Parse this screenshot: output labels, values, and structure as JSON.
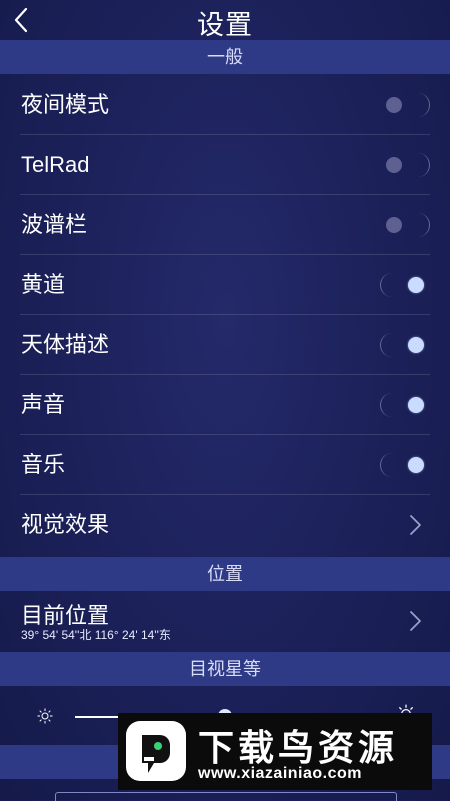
{
  "header": {
    "title": "设置"
  },
  "sections": {
    "general": "一般",
    "location": "位置",
    "magnitude": "目视星等"
  },
  "settings": [
    {
      "label": "夜间模式",
      "state": "off"
    },
    {
      "label": "TelRad",
      "state": "off"
    },
    {
      "label": "波谱栏",
      "state": "off"
    },
    {
      "label": "黄道",
      "state": "on"
    },
    {
      "label": "天体描述",
      "state": "on"
    },
    {
      "label": "声音",
      "state": "on"
    },
    {
      "label": "音乐",
      "state": "on"
    }
  ],
  "visual_effects": {
    "label": "视觉效果"
  },
  "location": {
    "label": "目前位置",
    "coordinates": "39° 54' 54''北 116° 24' 14''东"
  },
  "magnitude_slider": {
    "value_fraction": 0.5
  },
  "watermark": {
    "title": "下载鸟资源",
    "url": "www.xiazainiao.com"
  },
  "colors": {
    "background": "#1b2058",
    "section_band": "#2f3a86",
    "toggle_on_knob": "#c9dcff",
    "toggle_off_knob": "#5d6090"
  },
  "icons": {
    "back": "chevron-left-icon",
    "row_arrow": "chevron-right-icon",
    "dim": "sun-small-icon",
    "bright": "sun-large-icon"
  }
}
